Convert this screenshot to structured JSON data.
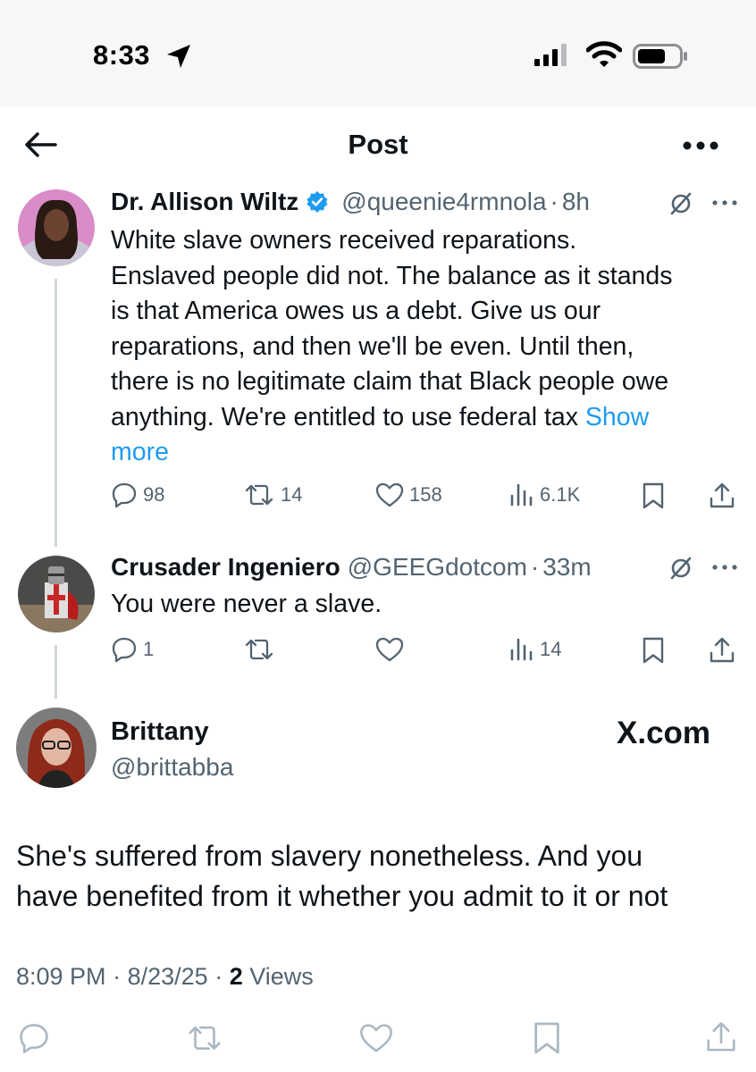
{
  "status_bar": {
    "time": "8:33"
  },
  "nav": {
    "title": "Post"
  },
  "post1": {
    "author": "Dr. Allison Wiltz",
    "handle": "@queenie4rmnola",
    "separator": "·",
    "time": "8h",
    "lines": [
      "White slave owners received reparations.",
      "Enslaved people did not. The balance as it stands",
      "is that America owes us a debt. Give us our",
      "reparations, and then we'll be even. Until then,",
      "there is no legitimate claim that Black people owe",
      "anything. We're entitled to use federal tax "
    ],
    "show": "Show",
    "more": "more",
    "replies": "98",
    "reposts": "14",
    "likes": "158",
    "views": "6.1K"
  },
  "post2": {
    "author": "Crusader Ingeniero",
    "handle": "@GEEGdotcom",
    "separator": "·",
    "time": "33m",
    "text": "You were never a slave.",
    "replies": "1",
    "views": "14"
  },
  "quote": {
    "author": "Brittany",
    "handle": "@brittabba",
    "site": "X.com",
    "lines": [
      "She's suffered from slavery nonetheless. And you",
      "have benefited from it whether you admit to it or not"
    ],
    "time": "8:09 PM",
    "separator": "·",
    "date": "8/23/25",
    "views_count": "2",
    "views_label": "Views"
  },
  "colors": {
    "accent": "#1d9bf0",
    "secondary_text": "#536471",
    "primary_text": "#0f1419",
    "thread_line": "#cfd9de"
  }
}
